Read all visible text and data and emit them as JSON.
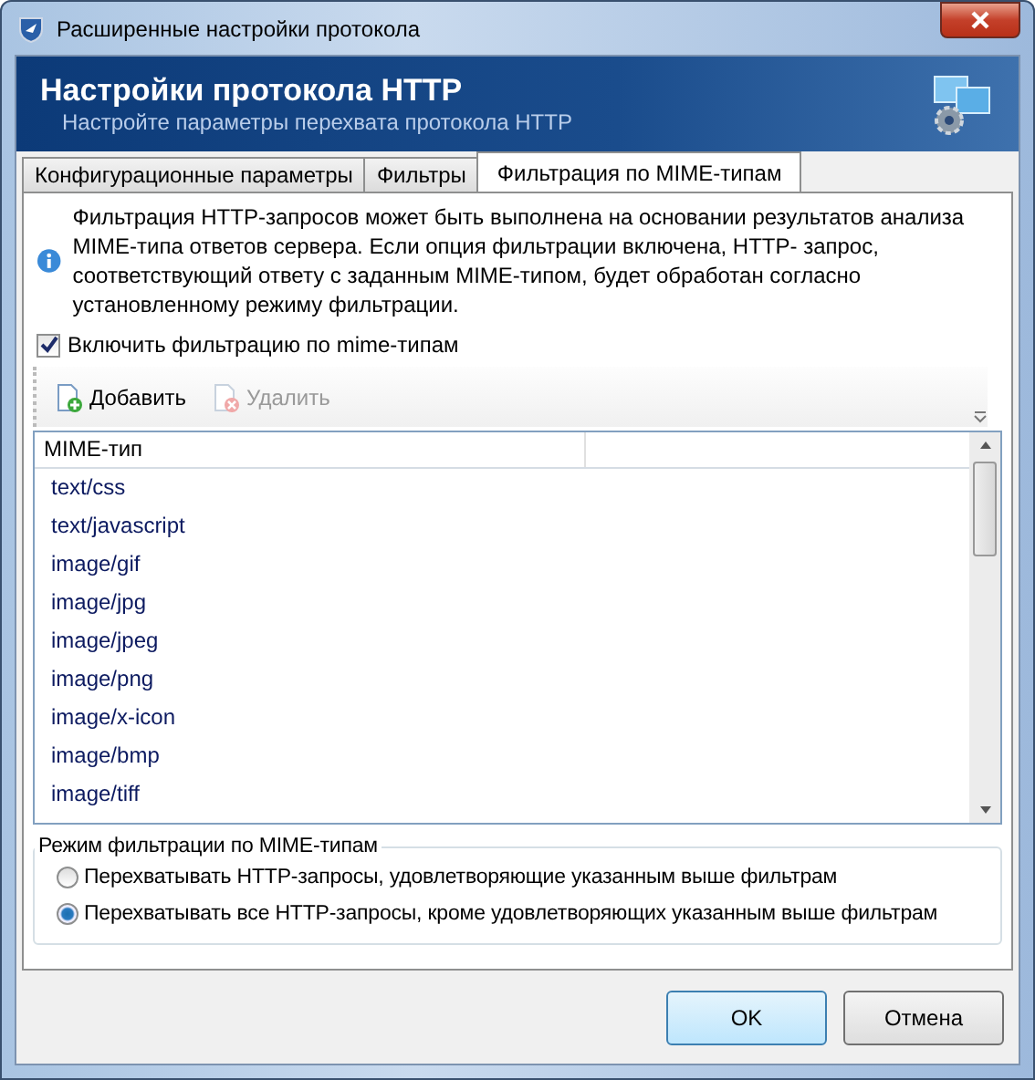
{
  "window": {
    "title": "Расширенные настройки протокола"
  },
  "header": {
    "title": "Настройки протокола HTTP",
    "subtitle": "Настройте параметры перехвата протокола HTTP"
  },
  "tabs": [
    {
      "label": "Конфигурационные параметры",
      "selected": false
    },
    {
      "label": "Фильтры",
      "selected": false
    },
    {
      "label": "Фильтрация по MIME-типам",
      "selected": true
    }
  ],
  "info": "Фильтрация HTTP-запросов может быть выполнена на основании результатов анализа MIME-типа ответов сервера. Если опция фильтрации включена, HTTP- запрос, соответствующий ответу с заданным MIME-типом, будет обработан согласно установленному режиму фильтрации.",
  "enable_filter": {
    "label": "Включить фильтрацию по mime-типам",
    "checked": true
  },
  "toolbar": [
    {
      "kind": "add",
      "label": "Добавить",
      "disabled": false
    },
    {
      "kind": "delete",
      "label": "Удалить",
      "disabled": true
    }
  ],
  "table": {
    "columns": [
      "MIME-тип"
    ],
    "rows": [
      "text/css",
      "text/javascript",
      "image/gif",
      "image/jpg",
      "image/jpeg",
      "image/png",
      "image/x-icon",
      "image/bmp",
      "image/tiff"
    ]
  },
  "mode": {
    "title": "Режим фильтрации по MIME-типам",
    "options": [
      {
        "label": "Перехватывать HTTP-запросы, удовлетворяющие указанным выше фильтрам",
        "selected": false
      },
      {
        "label": "Перехватывать все HTTP-запросы, кроме удовлетворяющих указанным выше фильтрам",
        "selected": true
      }
    ]
  },
  "buttons": [
    {
      "label": "OK",
      "default": true
    },
    {
      "label": "Отмена",
      "default": false
    }
  ]
}
